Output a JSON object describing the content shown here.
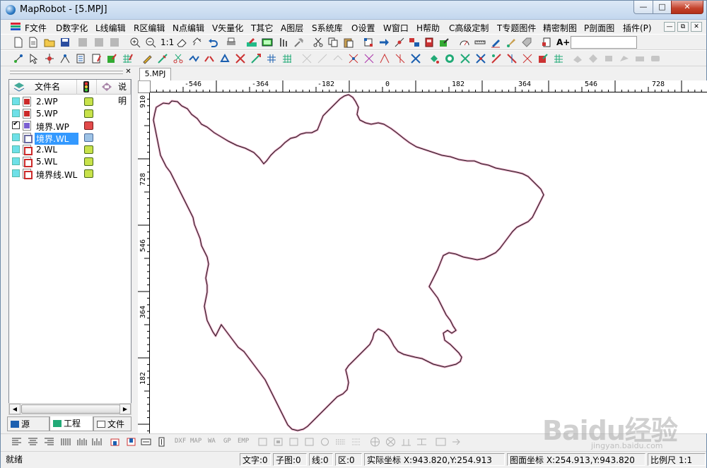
{
  "window": {
    "title": "MapRobot - [5.MPJ]",
    "min": "—",
    "max": "□",
    "close": "✕"
  },
  "menu": [
    "F文件",
    "D数字化",
    "L线编辑",
    "R区编辑",
    "N点编辑",
    "V矢量化",
    "T其它",
    "A图层",
    "S系统库",
    "O设置",
    "W窗口",
    "H帮助",
    "C高级定制",
    "T专题图件",
    "精密制图",
    "P剖面图",
    "插件(P)"
  ],
  "mdi_buttons": [
    "—",
    "⧉",
    "✕"
  ],
  "toolbar": {
    "zoom_ratio": "1:1",
    "font_label": "A+",
    "input_value": ""
  },
  "panel": {
    "close": "✕",
    "columns": {
      "name": "文件名",
      "status": "",
      "desc": "说明"
    },
    "files": [
      {
        "name": "2.WP",
        "checked": false,
        "type": "wp",
        "status": "green"
      },
      {
        "name": "5.WP",
        "checked": false,
        "type": "wp",
        "status": "green"
      },
      {
        "name": "境界.WP",
        "checked": true,
        "type": "open",
        "status": "red"
      },
      {
        "name": "境界.WL",
        "checked": false,
        "type": "blue",
        "status": "open",
        "selected": true
      },
      {
        "name": "2.WL",
        "checked": false,
        "type": "wl",
        "status": "green"
      },
      {
        "name": "5.WL",
        "checked": false,
        "type": "wl",
        "status": "green"
      },
      {
        "name": "境界线.WL",
        "checked": false,
        "type": "wl",
        "status": "green"
      }
    ],
    "tabs": [
      "源",
      "工程",
      "文件"
    ],
    "active_tab": "工程"
  },
  "doc_tab": "5.MPJ",
  "ruler": {
    "top": [
      "-546",
      "-364",
      "-182",
      "0",
      "182",
      "364",
      "546",
      "728"
    ],
    "left": [
      "910",
      "728",
      "546",
      "364",
      "182"
    ]
  },
  "bottom_toolbar": {
    "text_buttons": [
      "DXF",
      "MAP",
      "WA",
      "GP",
      "EMP"
    ]
  },
  "status": {
    "ready": "就绪",
    "text_count": "文字:0",
    "subpic_count": "子图:0",
    "line_count": "线:0",
    "area_count": "区:0",
    "real_coord": "实际坐标 X:943.820,Y:254.913",
    "map_coord": "图面坐标 X:254.913,Y:943.820",
    "scale": "比例尺 1:1"
  },
  "watermark": {
    "main": "Baidu经验",
    "sub": "jingyan.baidu.com"
  },
  "colors": {
    "boundary_outer": "#e8a0c0",
    "boundary_inner": "#1a1a1a",
    "selection": "#3399ff"
  }
}
